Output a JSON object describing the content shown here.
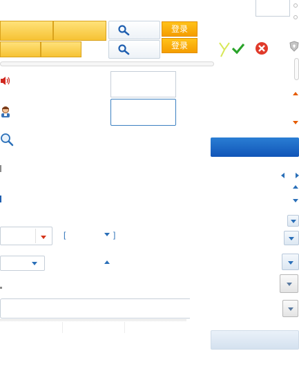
{
  "header": {
    "login_top": "登录",
    "login_bottom": "登录"
  },
  "icons": {
    "search": "magnifier-icon",
    "speaker": "speaker-icon",
    "user": "user-icon",
    "zoom": "zoom-search-icon",
    "check": "check-icon",
    "close": "close-icon",
    "shield": "shield-icon"
  },
  "dropdowns": {
    "bracket_left": "[",
    "bracket_right": "]"
  },
  "colors": {
    "accent": "#1565c8",
    "login": "#f7a800",
    "tile": "#f6c234",
    "close": "#e03a2a",
    "check": "#2aa32a"
  }
}
